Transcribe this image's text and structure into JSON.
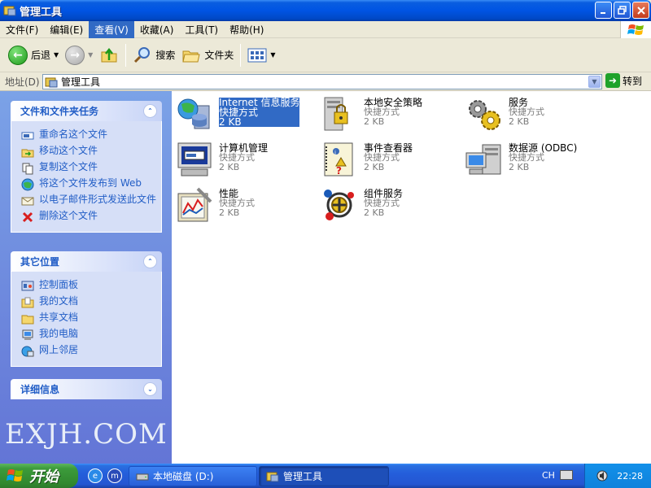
{
  "window": {
    "title": "管理工具",
    "controls": [
      "minimize",
      "maximize",
      "close"
    ]
  },
  "menu": {
    "items": [
      "文件(F)",
      "编辑(E)",
      "查看(V)",
      "收藏(A)",
      "工具(T)",
      "帮助(H)"
    ],
    "active_index": 2
  },
  "toolbar": {
    "back_label": "后退",
    "search_label": "搜索",
    "folders_label": "文件夹"
  },
  "address": {
    "label": "地址(D)",
    "value": "管理工具",
    "go_label": "转到"
  },
  "tasks_panel": {
    "title": "文件和文件夹任务",
    "items": [
      {
        "label": "重命名这个文件",
        "icon": "rename-icon"
      },
      {
        "label": "移动这个文件",
        "icon": "move-icon"
      },
      {
        "label": "复制这个文件",
        "icon": "copy-icon"
      },
      {
        "label": "将这个文件发布到 Web",
        "icon": "publish-web-icon"
      },
      {
        "label": "以电子邮件形式发送此文件",
        "icon": "email-icon"
      },
      {
        "label": "删除这个文件",
        "icon": "delete-icon"
      }
    ]
  },
  "other_places": {
    "title": "其它位置",
    "items": [
      {
        "label": "控制面板",
        "icon": "control-panel-icon"
      },
      {
        "label": "我的文档",
        "icon": "my-documents-icon"
      },
      {
        "label": "共享文档",
        "icon": "shared-documents-icon"
      },
      {
        "label": "我的电脑",
        "icon": "my-computer-icon"
      },
      {
        "label": "网上邻居",
        "icon": "network-places-icon"
      }
    ]
  },
  "details": {
    "title": "详细信息"
  },
  "watermark": "EXJH.COM",
  "files": [
    {
      "name": "Internet 信息服务",
      "type": "快捷方式",
      "size": "2 KB",
      "icon": "iis-icon",
      "selected": true
    },
    {
      "name": "本地安全策略",
      "type": "快捷方式",
      "size": "2 KB",
      "icon": "security-policy-icon"
    },
    {
      "name": "服务",
      "type": "快捷方式",
      "size": "2 KB",
      "icon": "services-icon"
    },
    {
      "name": "计算机管理",
      "type": "快捷方式",
      "size": "2 KB",
      "icon": "computer-management-icon"
    },
    {
      "name": "事件查看器",
      "type": "快捷方式",
      "size": "2 KB",
      "icon": "event-viewer-icon"
    },
    {
      "name": "数据源 (ODBC)",
      "type": "快捷方式",
      "size": "2 KB",
      "icon": "odbc-icon"
    },
    {
      "name": "性能",
      "type": "快捷方式",
      "size": "2 KB",
      "icon": "performance-icon"
    },
    {
      "name": "组件服务",
      "type": "快捷方式",
      "size": "2 KB",
      "icon": "component-services-icon"
    }
  ],
  "taskbar": {
    "start_label": "开始",
    "tasks": [
      {
        "label": "本地磁盘 (D:)",
        "icon": "drive-icon",
        "active": false
      },
      {
        "label": "管理工具",
        "icon": "folder-tools-icon",
        "active": true
      }
    ],
    "language": "CH",
    "clock": "22:28"
  }
}
